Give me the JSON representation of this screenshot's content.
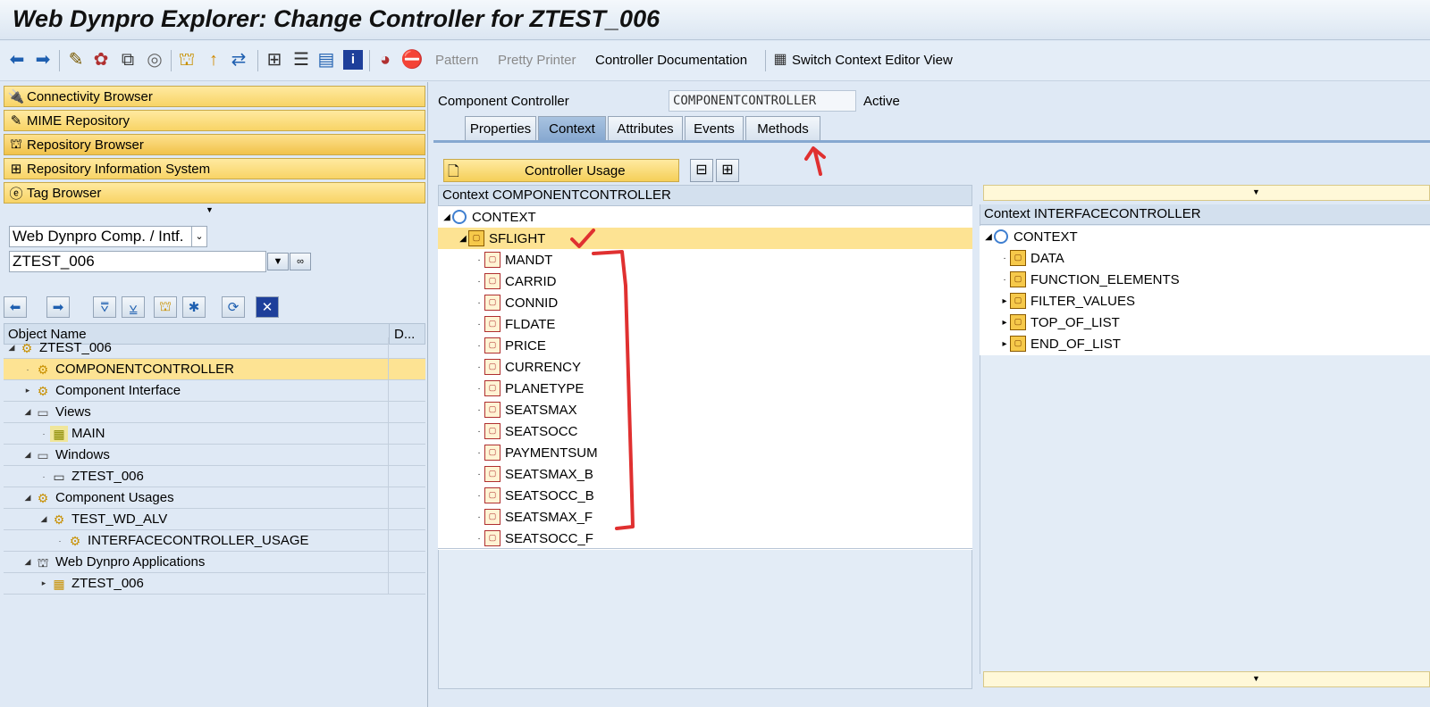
{
  "window": {
    "title": "Web Dynpro Explorer: Change Controller for ZTEST_006"
  },
  "toolbar": {
    "pattern_label": "Pattern",
    "pretty_printer_label": "Pretty Printer",
    "controller_doc_label": "Controller Documentation",
    "switch_ctx_label": "Switch Context Editor View"
  },
  "left": {
    "buttons": [
      {
        "label": "Connectivity Browser"
      },
      {
        "label": "MIME Repository"
      },
      {
        "label": "Repository Browser"
      },
      {
        "label": "Repository Information System"
      },
      {
        "label": "Tag Browser"
      }
    ],
    "object_type_select": "Web Dynpro Comp. / Intf.",
    "object_name_value": "ZTEST_006",
    "tree_header": {
      "col1": "Object Name",
      "col2": "D..."
    },
    "tree": [
      {
        "label": "ZTEST_006"
      },
      {
        "label": "COMPONENTCONTROLLER"
      },
      {
        "label": "Component Interface"
      },
      {
        "label": "Views"
      },
      {
        "label": "MAIN"
      },
      {
        "label": "Windows"
      },
      {
        "label": "ZTEST_006"
      },
      {
        "label": "Component Usages"
      },
      {
        "label": "TEST_WD_ALV"
      },
      {
        "label": "INTERFACECONTROLLER_USAGE"
      },
      {
        "label": "Web Dynpro Applications"
      },
      {
        "label": "ZTEST_006"
      }
    ]
  },
  "main": {
    "component_controller_label": "Component Controller",
    "component_controller_value": "COMPONENTCONTROLLER",
    "status": "Active",
    "tabs": [
      {
        "label": "Properties"
      },
      {
        "label": "Context"
      },
      {
        "label": "Attributes"
      },
      {
        "label": "Events"
      },
      {
        "label": "Methods"
      }
    ],
    "controller_usage_label": "Controller Usage",
    "context_panel": {
      "header": "Context COMPONENTCONTROLLER",
      "root": "CONTEXT",
      "node": "SFLIGHT",
      "attributes": [
        "MANDT",
        "CARRID",
        "CONNID",
        "FLDATE",
        "PRICE",
        "CURRENCY",
        "PLANETYPE",
        "SEATSMAX",
        "SEATSOCC",
        "PAYMENTSUM",
        "SEATSMAX_B",
        "SEATSOCC_B",
        "SEATSMAX_F",
        "SEATSOCC_F"
      ]
    },
    "iface_panel": {
      "header": "Context INTERFACECONTROLLER",
      "root": "CONTEXT",
      "nodes": [
        "DATA",
        "FUNCTION_ELEMENTS",
        "FILTER_VALUES",
        "TOP_OF_LIST",
        "END_OF_LIST"
      ]
    }
  },
  "colors": {
    "selection": "#fde393",
    "annotation_red": "#e03030",
    "tab_active": "#86a8d0"
  }
}
